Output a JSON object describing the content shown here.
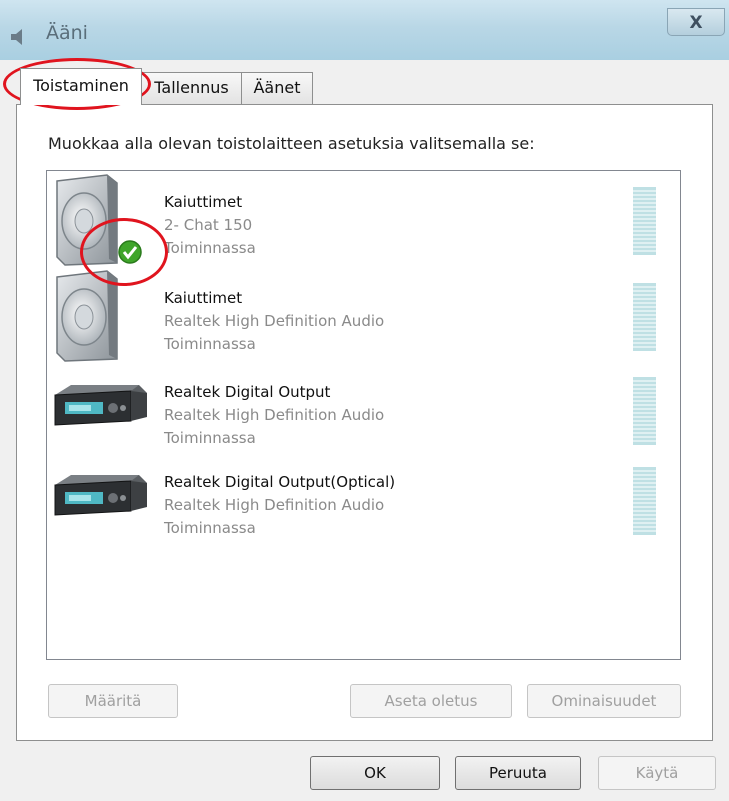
{
  "window": {
    "title": "Ääni",
    "close_label": "X"
  },
  "tabs": [
    {
      "label": "Toistaminen",
      "active": true
    },
    {
      "label": "Tallennus",
      "active": false
    },
    {
      "label": "Äänet",
      "active": false
    }
  ],
  "instruction": "Muokkaa alla olevan toistolaitteen asetuksia valitsemalla se:",
  "devices": [
    {
      "name": "Kaiuttimet",
      "description": "2- Chat 150",
      "status": "Toiminnassa",
      "icon": "speaker-icon",
      "is_default": true
    },
    {
      "name": "Kaiuttimet",
      "description": "Realtek High Definition Audio",
      "status": "Toiminnassa",
      "icon": "speaker-icon",
      "is_default": false
    },
    {
      "name": "Realtek Digital Output",
      "description": "Realtek High Definition Audio",
      "status": "Toiminnassa",
      "icon": "digital-output-device-icon",
      "is_default": false
    },
    {
      "name": "Realtek Digital Output(Optical)",
      "description": "Realtek High Definition Audio",
      "status": "Toiminnassa",
      "icon": "digital-output-device-icon",
      "is_default": false
    }
  ],
  "panel_buttons": {
    "configure": "Määritä",
    "set_default": "Aseta oletus",
    "properties": "Ominaisuudet"
  },
  "dialog_buttons": {
    "ok": "OK",
    "cancel": "Peruuta",
    "apply": "Käytä"
  },
  "colors": {
    "highlight_ring": "#e0141e",
    "default_check": "#3fa52a",
    "meter": "#bfe0e4"
  }
}
